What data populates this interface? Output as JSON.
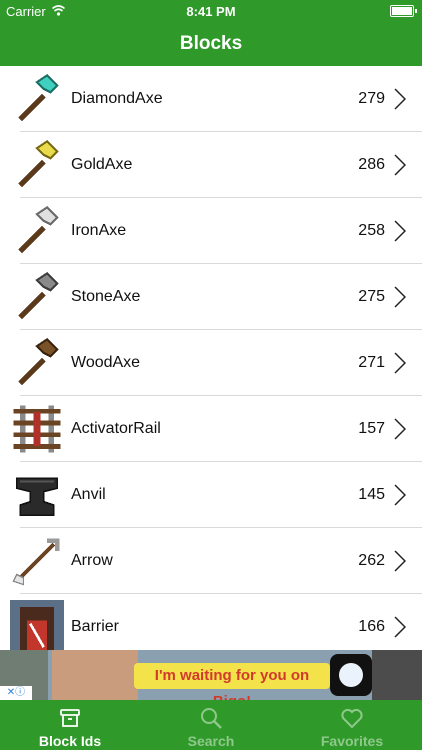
{
  "status": {
    "carrier": "Carrier",
    "time": "8:41 PM",
    "battery_level": 1.0
  },
  "navbar": {
    "title": "Blocks"
  },
  "items": [
    {
      "name": "DiamondAxe",
      "count": "279",
      "icon": "diamond-axe-icon"
    },
    {
      "name": "GoldAxe",
      "count": "286",
      "icon": "gold-axe-icon"
    },
    {
      "name": "IronAxe",
      "count": "258",
      "icon": "iron-axe-icon"
    },
    {
      "name": "StoneAxe",
      "count": "275",
      "icon": "stone-axe-icon"
    },
    {
      "name": "WoodAxe",
      "count": "271",
      "icon": "wood-axe-icon"
    },
    {
      "name": "ActivatorRail",
      "count": "157",
      "icon": "activator-rail-icon"
    },
    {
      "name": "Anvil",
      "count": "145",
      "icon": "anvil-icon"
    },
    {
      "name": "Arrow",
      "count": "262",
      "icon": "arrow-icon"
    },
    {
      "name": "Barrier",
      "count": "166",
      "icon": "barrier-icon"
    }
  ],
  "ad": {
    "text": "I'm waiting for you on Bigo!"
  },
  "tabs": [
    {
      "label": "Block Ids",
      "icon": "box-icon",
      "active": true
    },
    {
      "label": "Search",
      "icon": "search-icon",
      "active": false
    },
    {
      "label": "Favorites",
      "icon": "heart-icon",
      "active": false
    }
  ],
  "colors": {
    "brand": "#2f9a2a",
    "tab_inactive": "#8fc88b",
    "separator": "#d9d9d9"
  }
}
